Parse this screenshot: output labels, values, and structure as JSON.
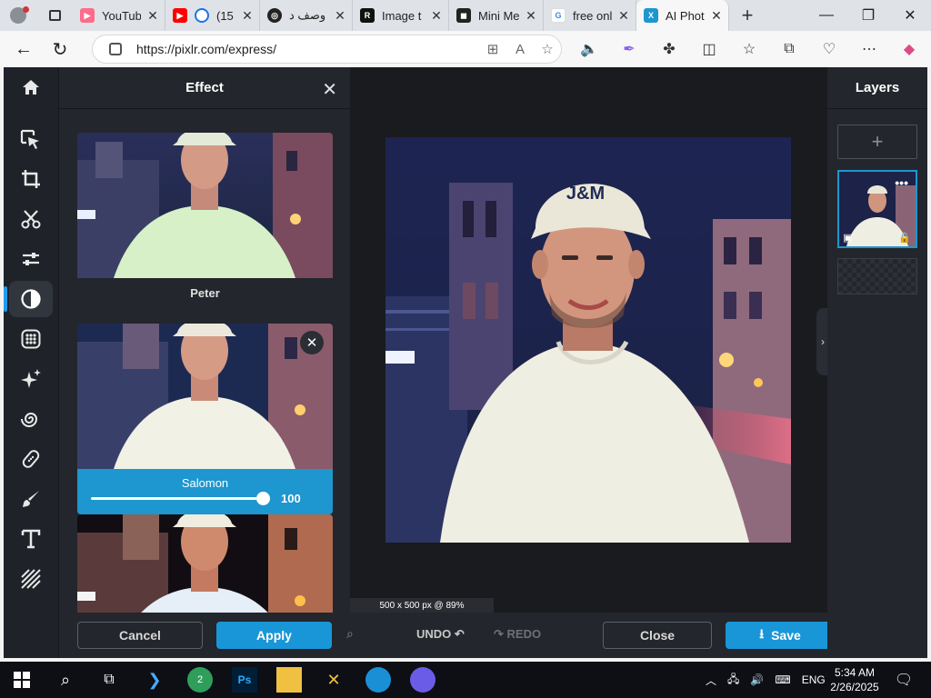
{
  "browser": {
    "tabs": [
      {
        "title": "YouTube",
        "fav_color": "#ff6b8a"
      },
      {
        "title": "(15",
        "fav_color": "#ff0000"
      },
      {
        "title": "وصف د",
        "fav_color": "#222222"
      },
      {
        "title": "Image t",
        "fav_color": "#111111"
      },
      {
        "title": "Mini Me",
        "fav_color": "#222222"
      },
      {
        "title": "free onl",
        "fav_color": "#4285f4"
      },
      {
        "title": "AI Phot",
        "fav_color": "#1e96cf",
        "active": true
      }
    ],
    "url": "https://pixlr.com/express/"
  },
  "tool_rail": {
    "items": [
      "home-icon",
      "select-icon",
      "crop-icon",
      "cutout-icon",
      "adjust-icon",
      "effect-icon",
      "filter-icon",
      "ai-icon",
      "liquify-icon",
      "retouch-icon",
      "draw-icon",
      "text-icon",
      "pattern-icon"
    ],
    "active": "effect-icon"
  },
  "effect_panel": {
    "title": "Effect",
    "effects": [
      {
        "name": "Peter",
        "tone": "cool"
      },
      {
        "name": "Salomon",
        "tone": "teal",
        "selected": true,
        "intensity": 100
      },
      {
        "name": "",
        "tone": "warm"
      }
    ],
    "cancel_label": "Cancel",
    "apply_label": "Apply"
  },
  "canvas": {
    "size_info": "500 x 500 px @ 89%",
    "cap_text": "J&M"
  },
  "bottom_bar": {
    "undo_label": "UNDO",
    "redo_label": "REDO",
    "close_label": "Close",
    "save_label": "Save"
  },
  "layers": {
    "title": "Layers"
  },
  "taskbar": {
    "time": "5:34 AM",
    "date": "2/26/2025",
    "lang": "ENG",
    "badge_count": "2"
  },
  "colors": {
    "accent": "#1e96cf",
    "panel_bg": "#23262c",
    "canvas_bg": "#1a1b1e"
  }
}
